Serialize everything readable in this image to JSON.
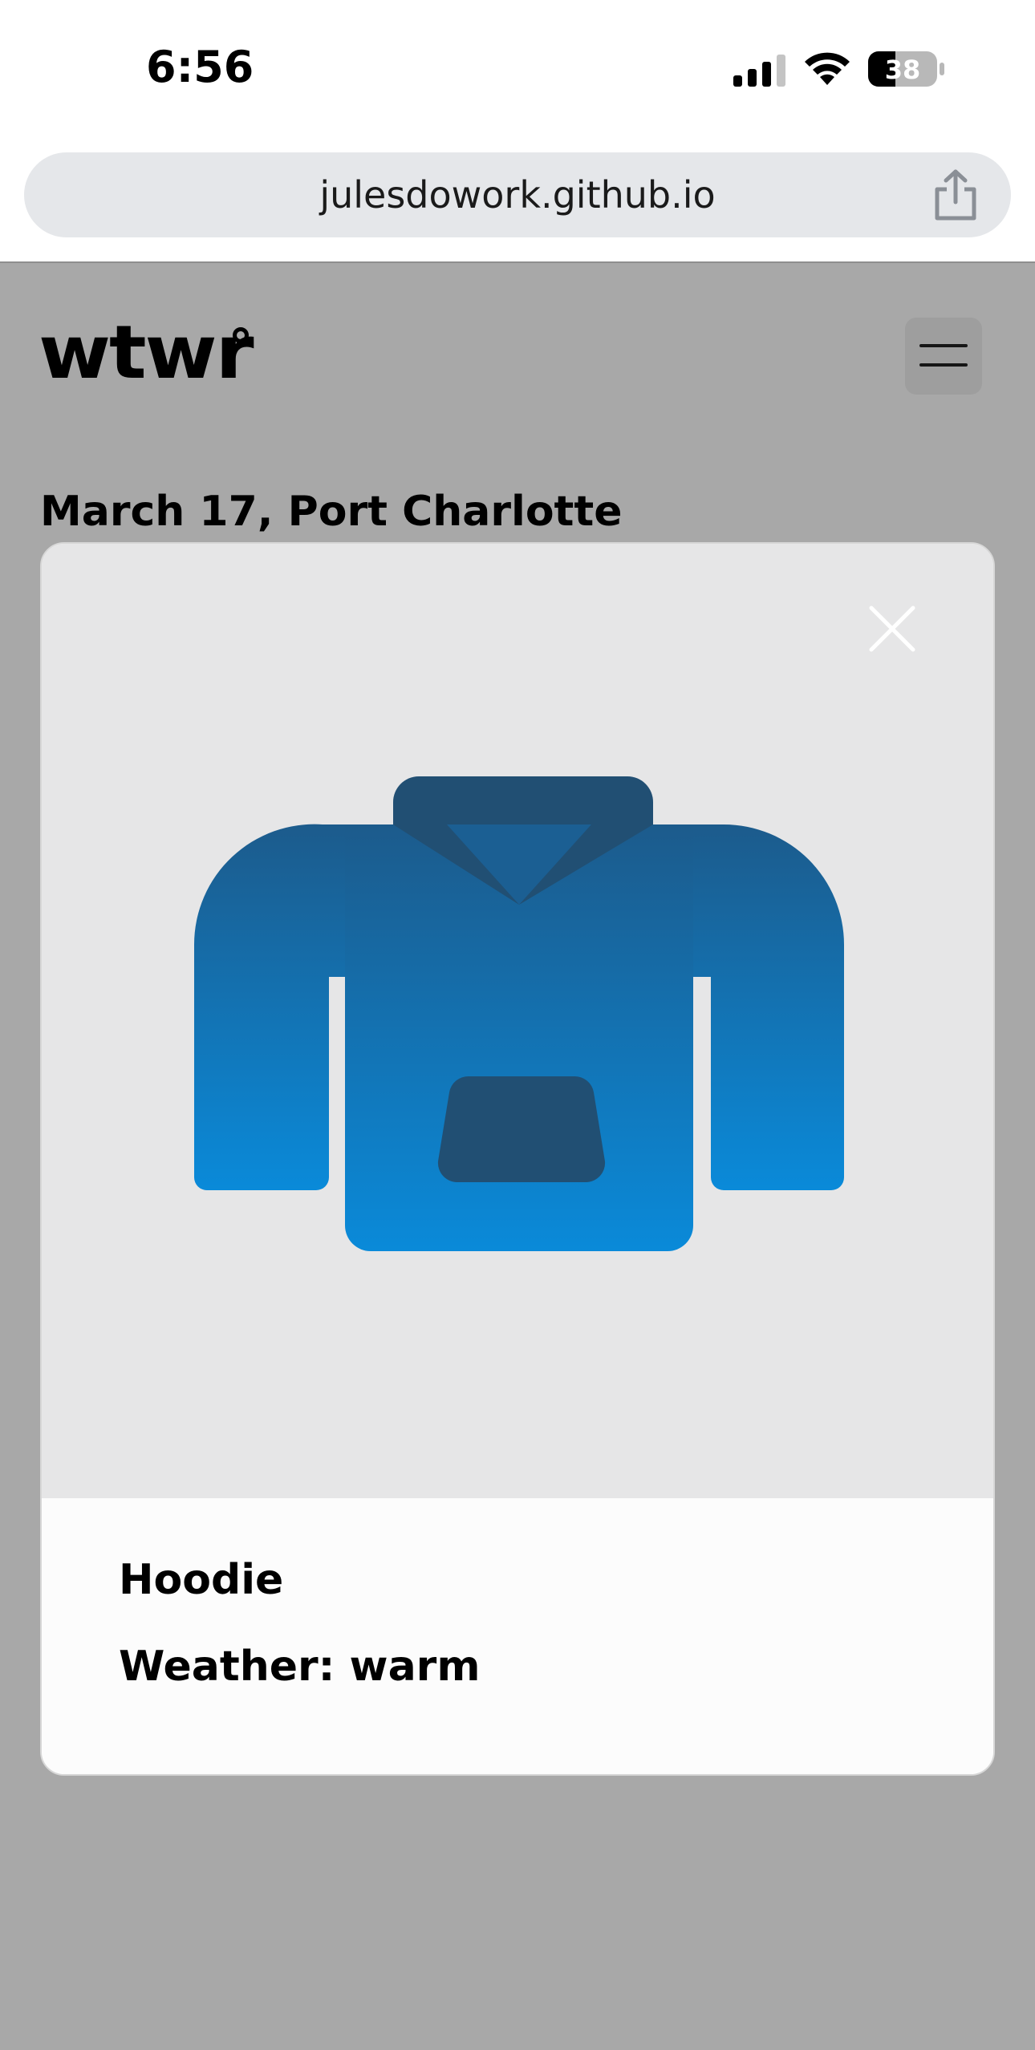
{
  "status_bar": {
    "time": "6:56",
    "battery_level": "38",
    "icons": [
      "signal-icon",
      "wifi-icon",
      "battery-icon"
    ]
  },
  "browser": {
    "url": "julesdowork.github.io",
    "share_icon": "share-icon"
  },
  "header": {
    "logo": "wtwr",
    "menu_icon": "hamburger-menu-icon"
  },
  "date_location": "March 17, Port Charlotte",
  "modal": {
    "item_name": "Hoodie",
    "weather": "Weather: warm",
    "image_icon": "hoodie-icon",
    "close_icon": "close-icon"
  },
  "colors": {
    "hoodie_top": "#1c5b8c",
    "hoodie_bottom": "#0a8ad9",
    "hoodie_dark": "#214f73",
    "overlay": "rgba(0,0,0,0.34)",
    "modal_image_bg": "#e6e6e7"
  }
}
